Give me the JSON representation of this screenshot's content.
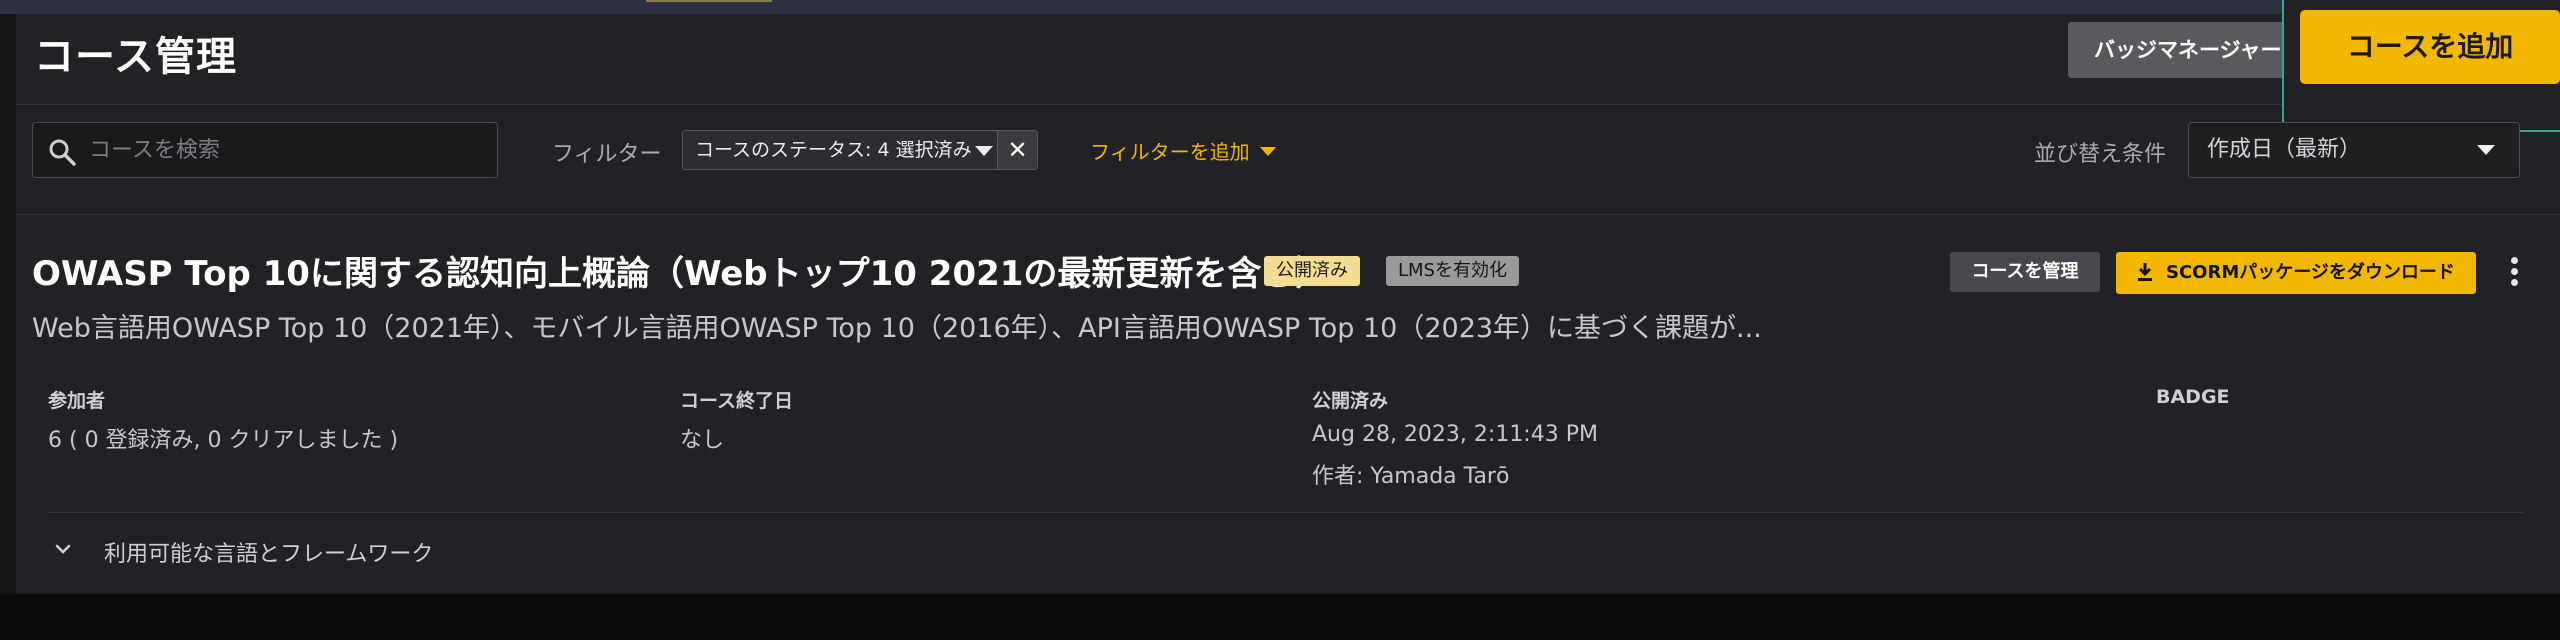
{
  "header": {
    "title": "コース管理",
    "badge_manager_label": "バッジマネージャー",
    "add_course_label": "コースを追加"
  },
  "toolbar": {
    "search_placeholder": "コースを検索",
    "filter_label": "フィルター",
    "filter_chip_text": "コースのステータス: 4 選択済み",
    "filter_clear_symbol": "✕",
    "add_filter_label": "フィルターを追加",
    "sort_label": "並び替え条件",
    "sort_value": "作成日（最新）"
  },
  "course": {
    "title": "OWASP Top 10に関する認知向上概論（Webトップ10 2021の最新更新を含む）",
    "status_badge": "公開済み",
    "lms_badge": "LMSを有効化",
    "manage_label": "コースを管理",
    "scorm_label": "SCORMパッケージをダウンロード",
    "description": "Web言語用OWASP Top 10（2021年）、モバイル言語用OWASP Top 10（2016年）、API言語用OWASP Top 10（2023年）に基づく課題が...",
    "meta": {
      "participants_label": "参加者",
      "participants_value": "6 ( 0 登録済み, 0 クリアしました )",
      "end_date_label": "コース終了日",
      "end_date_value": "なし",
      "published_label": "公開済み",
      "published_date": "Aug 28, 2023, 2:11:43 PM",
      "published_author": "作者: Yamada Tarō",
      "badge_label": "BADGE"
    },
    "expander_label": "利用可能な言語とフレームワーク"
  },
  "colors": {
    "accent": "#f2b700",
    "panel": "#222226",
    "focus_outline": "#2fa89a"
  }
}
